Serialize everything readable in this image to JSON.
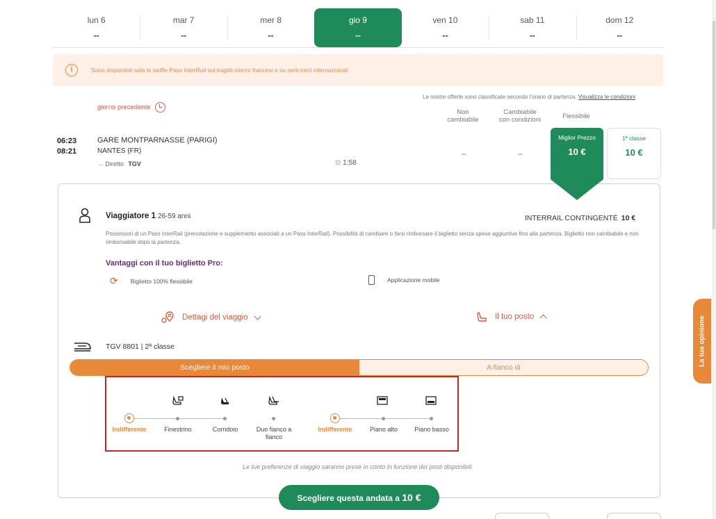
{
  "dates": [
    {
      "day": "lun 6",
      "price": "--",
      "active": false
    },
    {
      "day": "mar 7",
      "price": "--",
      "active": false
    },
    {
      "day": "mer 8",
      "price": "--",
      "active": false
    },
    {
      "day": "gio 9",
      "price": "--",
      "active": true
    },
    {
      "day": "ven 10",
      "price": "--",
      "active": false
    },
    {
      "day": "sab 11",
      "price": "--",
      "active": false
    },
    {
      "day": "dom 12",
      "price": "--",
      "active": false
    }
  ],
  "banner": {
    "text": "Sono disponibili solo le tariffe Pass InterRail sui tragitti interni francesi e su certi treni internazionali"
  },
  "offers_note": {
    "text": "Le nostre offerte sono classificate secondo l'orario di partenza.",
    "link": "Visualizza le condizioni"
  },
  "prev_day": "giorno precedente",
  "columns": {
    "non_changeable": [
      "Non",
      "cambiabile"
    ],
    "changeable": [
      "Cambiabile",
      "con condizioni"
    ],
    "flexible": "Flessibile"
  },
  "trip": {
    "dep_time": "06:23",
    "arr_time": "08:21",
    "from": "GARE MONTPARNASSE (PARIGI)",
    "to": "NANTES (FR)",
    "type": "Diretto",
    "train": "TGV",
    "duration": "1:58",
    "price_non_changeable": "–",
    "price_changeable": "–",
    "best_label": "Miglior Prezzo",
    "best_price": "10 €",
    "first_label": "1ª classe",
    "first_price": "10 €"
  },
  "traveller": {
    "title": "Viaggiatore 1",
    "age": "26-59 anni",
    "fare": "INTERRAIL CONTINGENTÉ",
    "fare_price": "10 €",
    "description": "Possessori di un Pass InterRail (prenotazione e supplemento associati a un Pass InterRail). Possibilità di cambiare o farsi rimborsare il biglietto senza spese aggiuntive fino alla partenza. Biglietto non cambiabile e non rimborsabile dopo la partenza.",
    "advantages_title": "Vantaggi con il tuo biglietto Pro:",
    "adv_flexible": "Biglietto 100% flessibile",
    "adv_mobile": "Applicazione mobile"
  },
  "toggles": {
    "trip_details": "Dettagi del viaggio",
    "your_seat": "Il tuo posto"
  },
  "train_info": "TGV 8801 | 2ª classe",
  "seat_tabs": {
    "choose": "Scegliere il mio posto",
    "next_to": "A fianco di"
  },
  "prefs": {
    "group1": [
      "Indifferente",
      "Finestrino",
      "Corridoio",
      "Duo fianco a fianco"
    ],
    "group2": [
      "Indifferente",
      "Piano alto",
      "Piano basso"
    ]
  },
  "footnote": "Le tue preferenze di viaggio saranno prese in conto in funzione dei posti disponibili.",
  "cta": {
    "label": "Scegliere questa andata a",
    "price": "10 €"
  },
  "feedback": "La tua opinione",
  "colors": {
    "green": "#1f8a5a",
    "orange": "#e8893a",
    "red": "#e0563a",
    "purple": "#6b2a7a",
    "highlight": "#d32025"
  }
}
